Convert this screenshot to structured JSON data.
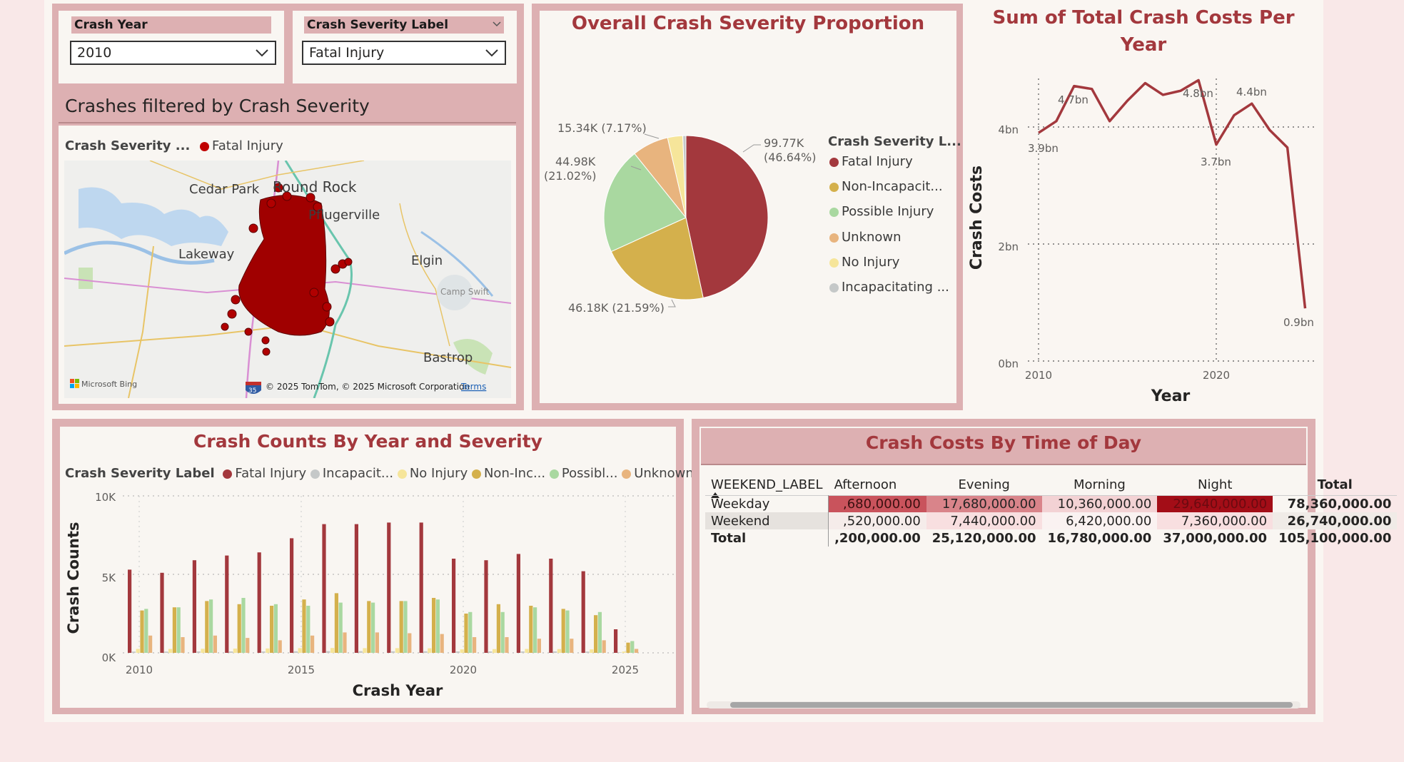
{
  "slicers": {
    "year": {
      "title": "Crash Year",
      "value": "2010"
    },
    "severity": {
      "title": "Crash Severity Label",
      "value": "Fatal Injury"
    }
  },
  "map": {
    "title": "Crashes filtered by Crash Severity",
    "legend_label": "Crash Severity ...",
    "legend_item": "Fatal Injury",
    "places": [
      "Cedar Park",
      "Round Rock",
      "Pflugerville",
      "Lakeway",
      "Elgin",
      "Camp Swift",
      "Bastrop"
    ],
    "attribution": "© 2025 TomTom, © 2025 Microsoft Corporation",
    "terms": "Terms",
    "bing": "Microsoft Bing",
    "shield": "35"
  },
  "pie": {
    "title": "Overall Crash Severity Proportion",
    "legend_title": "Crash Severity L...",
    "legend": [
      "Fatal Injury",
      "Non-Incapacit...",
      "Possible Injury",
      "Unknown",
      "No Injury",
      "Incapacitating ..."
    ],
    "labels": {
      "fatal": "99.77K\n(46.64%)",
      "nonincap": "46.18K (21.59%)",
      "possible": "44.98K\n(21.02%)",
      "unknown": "15.34K (7.17%)"
    }
  },
  "line": {
    "title": "Sum of Total Crash Costs Per Year",
    "ylabel": "Crash Costs",
    "xlabel": "Year",
    "yticks": [
      "0bn",
      "2bn",
      "4bn"
    ],
    "xticks": [
      "2010",
      "2020"
    ],
    "annotations": [
      "3.9bn",
      "4.7bn",
      "4.8bn",
      "4.4bn",
      "3.7bn",
      "0.9bn"
    ]
  },
  "bar": {
    "title": "Crash Counts By Year and Severity",
    "legend_title": "Crash Severity Label",
    "legend": [
      "Fatal Injury",
      "Incapacit...",
      "No Injury",
      "Non-Inc...",
      "Possibl...",
      "Unknown"
    ],
    "ylabel": "Crash Counts",
    "xlabel": "Crash Year",
    "yticks": [
      "0K",
      "5K",
      "10K"
    ],
    "xticks": [
      "2010",
      "2015",
      "2020",
      "2025"
    ]
  },
  "matrix": {
    "title": "Crash Costs By Time of Day",
    "columns": [
      "WEEKEND_LABEL",
      "Afternoon",
      "Evening",
      "Morning",
      "Night",
      "Total"
    ],
    "rows": [
      [
        "Weekday",
        ",680,000.00",
        "17,680,000.00",
        "10,360,000.00",
        "29,640,000.00",
        "78,360,000.00"
      ],
      [
        "Weekend",
        ",520,000.00",
        "7,440,000.00",
        "6,420,000.00",
        "7,360,000.00",
        "26,740,000.00"
      ],
      [
        "Total",
        ",200,000.00",
        "25,120,000.00",
        "16,780,000.00",
        "37,000,000.00",
        "105,100,000.00"
      ]
    ]
  },
  "colors": {
    "fatal": "#a3383d",
    "nonincap": "#d4b04c",
    "possible": "#a9d8a0",
    "unknown": "#e8b47e",
    "noinjury": "#f6e59a",
    "incap": "#c5c8c8",
    "panel": "#ddb0b2",
    "title": "#a3383d"
  },
  "chart_data": [
    {
      "type": "pie",
      "title": "Overall Crash Severity Proportion",
      "categories": [
        "Fatal Injury",
        "Non-Incapacitating",
        "Possible Injury",
        "Unknown",
        "No Injury",
        "Incapacitating"
      ],
      "values": [
        99770,
        46180,
        44980,
        15340,
        6400,
        1300
      ]
    },
    {
      "type": "line",
      "title": "Sum of Total Crash Costs Per Year",
      "xlabel": "Year",
      "ylabel": "Crash Costs",
      "x": [
        2010,
        2011,
        2012,
        2013,
        2014,
        2015,
        2016,
        2017,
        2018,
        2019,
        2020,
        2021,
        2022,
        2023,
        2024,
        2025
      ],
      "y": [
        3.9,
        4.1,
        4.7,
        4.65,
        4.1,
        4.45,
        4.75,
        4.55,
        4.62,
        4.8,
        3.7,
        4.2,
        4.4,
        3.95,
        3.65,
        0.9
      ],
      "ylim": [
        0,
        5
      ],
      "units": "bn"
    },
    {
      "type": "bar",
      "title": "Crash Counts By Year and Severity",
      "xlabel": "Crash Year",
      "ylabel": "Crash Counts",
      "categories": [
        "2010",
        "2011",
        "2012",
        "2013",
        "2014",
        "2015",
        "2016",
        "2017",
        "2018",
        "2019",
        "2020",
        "2021",
        "2022",
        "2023",
        "2024",
        "2025"
      ],
      "ylim": [
        0,
        10000
      ],
      "series": [
        {
          "name": "Fatal Injury",
          "values": [
            5300,
            5100,
            5900,
            6200,
            6400,
            7300,
            8200,
            8200,
            8300,
            8300,
            6000,
            5900,
            6300,
            6000,
            5200,
            1500
          ]
        },
        {
          "name": "Incapacitating",
          "values": [
            80,
            80,
            90,
            90,
            90,
            100,
            110,
            110,
            100,
            100,
            90,
            90,
            90,
            90,
            80,
            30
          ]
        },
        {
          "name": "No Injury",
          "values": [
            250,
            250,
            260,
            270,
            280,
            300,
            310,
            300,
            300,
            290,
            220,
            240,
            250,
            240,
            220,
            80
          ]
        },
        {
          "name": "Non-Incapacitating",
          "values": [
            2700,
            2900,
            3300,
            3100,
            3000,
            3400,
            3800,
            3300,
            3300,
            3500,
            2500,
            3100,
            3000,
            2800,
            2400,
            650
          ]
        },
        {
          "name": "Possible Injury",
          "values": [
            2800,
            2900,
            3400,
            3500,
            3100,
            3000,
            3200,
            3200,
            3300,
            3400,
            2600,
            2600,
            2900,
            2700,
            2600,
            750
          ]
        },
        {
          "name": "Unknown",
          "values": [
            1100,
            1000,
            1100,
            950,
            800,
            1100,
            1300,
            1300,
            1250,
            1200,
            1000,
            1000,
            900,
            900,
            800,
            250
          ]
        }
      ]
    },
    {
      "type": "table",
      "title": "Crash Costs By Time of Day",
      "columns": [
        "WEEKEND_LABEL",
        "Afternoon",
        "Evening",
        "Morning",
        "Night",
        "Total"
      ],
      "rows": [
        [
          "Weekday",
          "…,680,000.00",
          "17,680,000.00",
          "10,360,000.00",
          "29,640,000.00",
          "78,360,000.00"
        ],
        [
          "Weekend",
          "…,520,000.00",
          "7,440,000.00",
          "6,420,000.00",
          "7,360,000.00",
          "26,740,000.00"
        ],
        [
          "Total",
          "…,200,000.00",
          "25,120,000.00",
          "16,780,000.00",
          "37,000,000.00",
          "105,100,000.00"
        ]
      ]
    }
  ]
}
